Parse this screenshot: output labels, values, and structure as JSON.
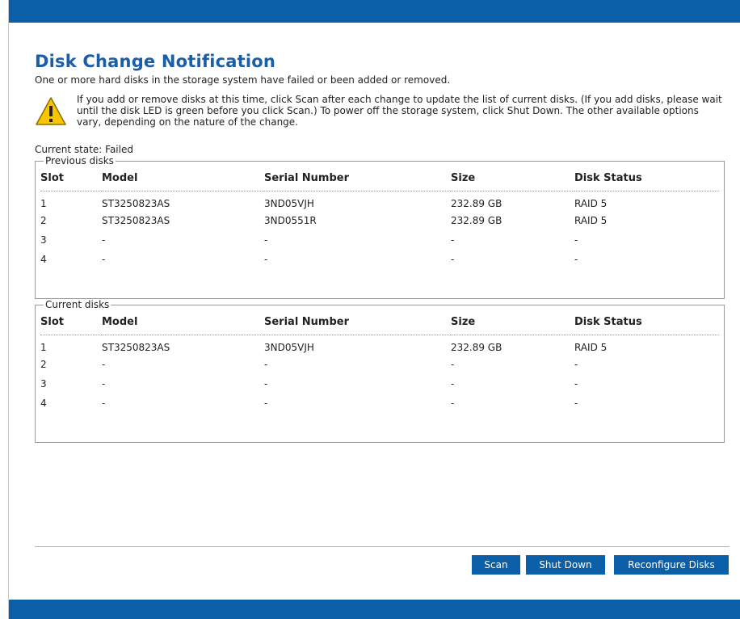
{
  "header": {
    "title": "Disk Change Notification",
    "subtitle": "One or more hard disks in the storage system have failed or been added or removed."
  },
  "notice": {
    "icon": "warning-icon",
    "text": "If you add or remove disks at this time, click Scan after each change to update the list of current disks. (If you add disks, please wait until the disk LED is green before you click Scan.) To power off the storage system, click Shut Down. The other available options vary, depending on the nature of the change."
  },
  "state": {
    "label": "Current state:",
    "value": "Failed"
  },
  "columns": [
    "Slot",
    "Model",
    "Serial Number",
    "Size",
    "Disk Status"
  ],
  "previous_disks": {
    "legend": "Previous disks",
    "rows": [
      [
        "1",
        "ST3250823AS",
        "3ND05VJH",
        "232.89 GB",
        "RAID 5"
      ],
      [
        "2",
        "ST3250823AS",
        "3ND0551R",
        "232.89 GB",
        "RAID 5"
      ],
      [
        "3",
        "-",
        "-",
        "-",
        "-"
      ],
      [
        "4",
        "-",
        "-",
        "-",
        "-"
      ]
    ]
  },
  "current_disks": {
    "legend": "Current disks",
    "rows": [
      [
        "1",
        "ST3250823AS",
        "3ND05VJH",
        "232.89 GB",
        "RAID 5"
      ],
      [
        "2",
        "-",
        "-",
        "-",
        "-"
      ],
      [
        "3",
        "-",
        "-",
        "-",
        "-"
      ],
      [
        "4",
        "-",
        "-",
        "-",
        "-"
      ]
    ]
  },
  "buttons": {
    "scan": "Scan",
    "shut_down": "Shut Down",
    "reconfigure": "Reconfigure Disks"
  },
  "colors": {
    "brand_blue": "#0a5fa8",
    "title_blue": "#1b5ea8",
    "warning_yellow": "#f7c600"
  }
}
